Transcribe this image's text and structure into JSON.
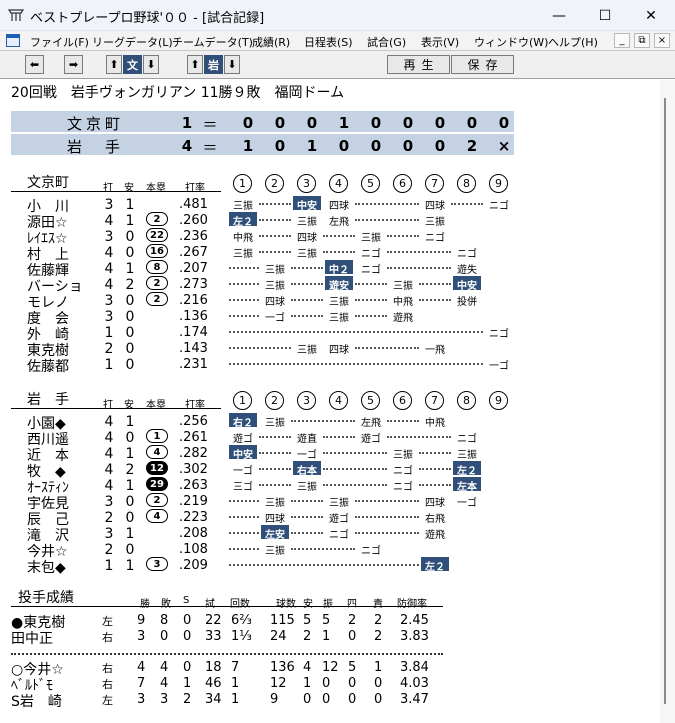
{
  "window": {
    "title": "ベストプレープロ野球'００ - [試合記録]",
    "minimize": "—",
    "maximize": "☐",
    "close": "✕"
  },
  "menu": {
    "items": [
      "ファイル(F)",
      "リーグデータ(L)",
      "チームデータ(T)",
      "成績(R)",
      "日程表(S)",
      "試合(G)",
      "表示(V)",
      "ウィンドウ(W)",
      "ヘルプ(H)"
    ],
    "mdi_min": "_",
    "mdi_restore": "⧉",
    "mdi_close": "×"
  },
  "toolbar": {
    "prev": "⬅",
    "next": "➡",
    "team1_up": "⬆",
    "team1_label": "文",
    "team1_down": "⬇",
    "team2_up": "⬆",
    "team2_label": "岩",
    "team2_down": "⬇",
    "play": "再生",
    "save": "保存"
  },
  "game": {
    "header": "20回戦　岩手ヴォンガリアン 11勝９敗　福岡ドーム"
  },
  "linescore": [
    {
      "team": "文京町",
      "total": "1",
      "eq": "＝",
      "innings": [
        "0",
        "0",
        "0",
        "1",
        "0",
        "0",
        "0",
        "0",
        "0"
      ]
    },
    {
      "team": "岩　手",
      "total": "4",
      "eq": "＝",
      "innings": [
        "1",
        "0",
        "1",
        "0",
        "0",
        "0",
        "0",
        "2",
        "×"
      ]
    }
  ],
  "batting_columns": [
    "打",
    "安",
    "本塁",
    "打率"
  ],
  "inning_labels": [
    "①",
    "②",
    "③",
    "④",
    "⑤",
    "⑥",
    "⑦",
    "⑧",
    "⑨"
  ],
  "away": {
    "team": "文京町",
    "players": [
      {
        "name": "小　川",
        "ab": "3",
        "h": "1",
        "hr": "",
        "avg": ".481",
        "results": [
          {
            "i": 1,
            "t": "三振"
          },
          {
            "i": 3,
            "t": "中安",
            "hit": true
          },
          {
            "i": 4,
            "t": "四球"
          },
          {
            "i": 7,
            "t": "四球"
          },
          {
            "i": 9,
            "t": "ニゴ"
          }
        ]
      },
      {
        "name": "源田☆",
        "ab": "4",
        "h": "1",
        "hr": "2",
        "hrfill": false,
        "avg": ".260",
        "results": [
          {
            "i": 1,
            "t": "左２",
            "hit": true
          },
          {
            "i": 3,
            "t": "三振"
          },
          {
            "i": 4,
            "t": "左飛"
          },
          {
            "i": 7,
            "t": "三振"
          }
        ]
      },
      {
        "name": "ﾚｲｴｽ☆",
        "ab": "3",
        "h": "0",
        "hr": "22",
        "hrfill": false,
        "avg": ".236",
        "results": [
          {
            "i": 1,
            "t": "中飛"
          },
          {
            "i": 3,
            "t": "四球"
          },
          {
            "i": 5,
            "t": "三振"
          },
          {
            "i": 7,
            "t": "ニゴ"
          }
        ]
      },
      {
        "name": "村　上",
        "ab": "4",
        "h": "0",
        "hr": "16",
        "hrfill": false,
        "avg": ".267",
        "results": [
          {
            "i": 1,
            "t": "三振"
          },
          {
            "i": 3,
            "t": "三振"
          },
          {
            "i": 5,
            "t": "ニゴ"
          },
          {
            "i": 8,
            "t": "ニゴ"
          }
        ]
      },
      {
        "name": "佐藤輝",
        "ab": "4",
        "h": "1",
        "hr": "8",
        "hrfill": false,
        "avg": ".207",
        "results": [
          {
            "i": 2,
            "t": "三振"
          },
          {
            "i": 4,
            "t": "中２",
            "hit": true
          },
          {
            "i": 5,
            "t": "ニゴ"
          },
          {
            "i": 8,
            "t": "遊失"
          }
        ]
      },
      {
        "name": "バーショ",
        "ab": "4",
        "h": "2",
        "hr": "2",
        "hrfill": false,
        "avg": ".273",
        "results": [
          {
            "i": 2,
            "t": "三振"
          },
          {
            "i": 4,
            "t": "遊安",
            "hit": true
          },
          {
            "i": 6,
            "t": "三振"
          },
          {
            "i": 8,
            "t": "中安",
            "hit": true
          }
        ]
      },
      {
        "name": "モレノ",
        "ab": "3",
        "h": "0",
        "hr": "2",
        "hrfill": false,
        "avg": ".216",
        "results": [
          {
            "i": 2,
            "t": "四球"
          },
          {
            "i": 4,
            "t": "三振"
          },
          {
            "i": 6,
            "t": "中飛"
          },
          {
            "i": 8,
            "t": "投併"
          }
        ]
      },
      {
        "name": "度　会",
        "ab": "3",
        "h": "0",
        "hr": "",
        "avg": ".136",
        "results": [
          {
            "i": 2,
            "t": "一ゴ"
          },
          {
            "i": 4,
            "t": "三振"
          },
          {
            "i": 6,
            "t": "遊飛"
          }
        ]
      },
      {
        "name": "外　崎",
        "ab": "1",
        "h": "0",
        "hr": "",
        "avg": ".174",
        "results": [
          {
            "i": 9,
            "t": "ニゴ"
          }
        ]
      },
      {
        "name": "東克樹",
        "ab": "2",
        "h": "0",
        "hr": "",
        "avg": ".143",
        "results": [
          {
            "i": 3,
            "t": "三振"
          },
          {
            "i": 4,
            "t": "四球"
          },
          {
            "i": 7,
            "t": "一飛"
          }
        ]
      },
      {
        "name": "佐藤都",
        "ab": "1",
        "h": "0",
        "hr": "",
        "avg": ".231",
        "results": [
          {
            "i": 9,
            "t": "一ゴ"
          }
        ]
      }
    ]
  },
  "home": {
    "team": "岩　手",
    "players": [
      {
        "name": "小園◆",
        "ab": "4",
        "h": "1",
        "hr": "",
        "avg": ".256",
        "results": [
          {
            "i": 1,
            "t": "右２",
            "hit": true
          },
          {
            "i": 2,
            "t": "三振"
          },
          {
            "i": 5,
            "t": "左飛"
          },
          {
            "i": 7,
            "t": "中飛"
          }
        ]
      },
      {
        "name": "西川遥",
        "ab": "4",
        "h": "0",
        "hr": "1",
        "hrfill": false,
        "avg": ".261",
        "results": [
          {
            "i": 1,
            "t": "遊ゴ"
          },
          {
            "i": 3,
            "t": "遊直"
          },
          {
            "i": 5,
            "t": "遊ゴ"
          },
          {
            "i": 8,
            "t": "ニゴ"
          }
        ]
      },
      {
        "name": "近　本",
        "ab": "4",
        "h": "1",
        "hr": "4",
        "hrfill": false,
        "avg": ".282",
        "results": [
          {
            "i": 1,
            "t": "中安",
            "hit": true
          },
          {
            "i": 3,
            "t": "一ゴ"
          },
          {
            "i": 6,
            "t": "三振"
          },
          {
            "i": 8,
            "t": "三振"
          }
        ]
      },
      {
        "name": "牧　◆",
        "ab": "4",
        "h": "2",
        "hr": "12",
        "hrfill": true,
        "avg": ".302",
        "results": [
          {
            "i": 1,
            "t": "一ゴ"
          },
          {
            "i": 3,
            "t": "右本",
            "hit": true
          },
          {
            "i": 6,
            "t": "ニゴ"
          },
          {
            "i": 8,
            "t": "左２",
            "hit": true
          }
        ]
      },
      {
        "name": "ｵｰｽﾃｨﾝ",
        "ab": "4",
        "h": "1",
        "hr": "29",
        "hrfill": true,
        "avg": ".263",
        "results": [
          {
            "i": 1,
            "t": "三ゴ"
          },
          {
            "i": 3,
            "t": "三振"
          },
          {
            "i": 6,
            "t": "ニゴ"
          },
          {
            "i": 8,
            "t": "左本",
            "hit": true
          }
        ]
      },
      {
        "name": "宇佐見",
        "ab": "3",
        "h": "0",
        "hr": "2",
        "hrfill": false,
        "avg": ".219",
        "results": [
          {
            "i": 2,
            "t": "三振"
          },
          {
            "i": 4,
            "t": "三振"
          },
          {
            "i": 7,
            "t": "四球"
          },
          {
            "i": 8,
            "t": "一ゴ"
          }
        ]
      },
      {
        "name": "辰　己",
        "ab": "2",
        "h": "0",
        "hr": "4",
        "hrfill": false,
        "avg": ".223",
        "results": [
          {
            "i": 2,
            "t": "四球"
          },
          {
            "i": 4,
            "t": "遊ゴ"
          },
          {
            "i": 7,
            "t": "右飛"
          }
        ]
      },
      {
        "name": "滝　沢",
        "ab": "3",
        "h": "1",
        "hr": "",
        "avg": ".208",
        "results": [
          {
            "i": 2,
            "t": "左安",
            "hit": true
          },
          {
            "i": 4,
            "t": "ニゴ"
          },
          {
            "i": 7,
            "t": "遊飛"
          }
        ]
      },
      {
        "name": "今井☆",
        "ab": "2",
        "h": "0",
        "hr": "",
        "avg": ".108",
        "results": [
          {
            "i": 2,
            "t": "三振"
          },
          {
            "i": 5,
            "t": "ニゴ"
          }
        ]
      },
      {
        "name": "末包◆",
        "ab": "1",
        "h": "1",
        "hr": "3",
        "hrfill": false,
        "avg": ".209",
        "results": [
          {
            "i": 7,
            "t": "左２",
            "hit": true
          }
        ]
      }
    ]
  },
  "pitching": {
    "title": "投手成績",
    "columns": [
      "勝",
      "敗",
      "S",
      "試",
      "回数",
      "球数",
      "安",
      "振",
      "四",
      "責",
      "防御率"
    ],
    "away": [
      {
        "name": "●東克樹",
        "hand": "左",
        "w": "9",
        "l": "8",
        "s": "0",
        "g": "22",
        "ip": "6⅔",
        "np": "115",
        "h": "5",
        "k": "5",
        "bb": "2",
        "er": "2",
        "era": "2.45"
      },
      {
        "name": "田中正",
        "hand": "右",
        "w": "3",
        "l": "0",
        "s": "0",
        "g": "33",
        "ip": "1⅓",
        "np": "24",
        "h": "2",
        "k": "1",
        "bb": "0",
        "er": "2",
        "era": "3.83"
      }
    ],
    "home": [
      {
        "name": "○今井☆",
        "hand": "右",
        "w": "4",
        "l": "4",
        "s": "0",
        "g": "18",
        "ip": "7",
        "np": "136",
        "h": "4",
        "k": "12",
        "bb": "5",
        "er": "1",
        "era": "3.84"
      },
      {
        "name": "ﾍﾞﾙﾄﾞﾓ",
        "hand": "右",
        "w": "7",
        "l": "4",
        "s": "1",
        "g": "46",
        "ip": "1",
        "np": "12",
        "h": "1",
        "k": "0",
        "bb": "0",
        "er": "0",
        "era": "4.03"
      },
      {
        "name": "S岩　崎",
        "hand": "左",
        "w": "3",
        "l": "3",
        "s": "2",
        "g": "34",
        "ip": "1",
        "np": "9",
        "h": "0",
        "k": "0",
        "bb": "0",
        "er": "0",
        "era": "3.47"
      }
    ]
  }
}
